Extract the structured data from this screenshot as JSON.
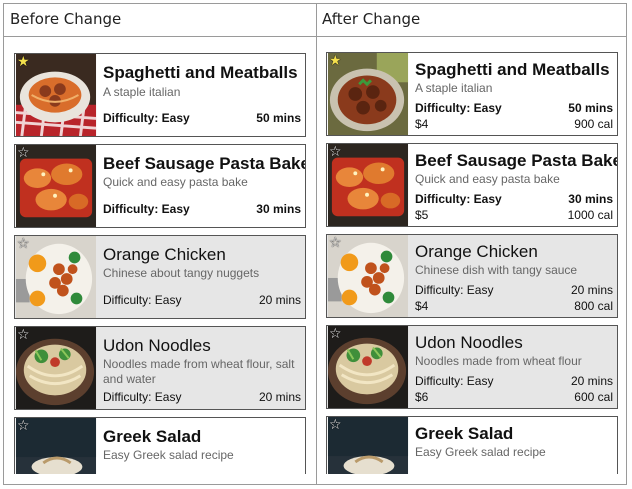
{
  "table": {
    "before_label": "Before Change",
    "after_label": "After Change"
  },
  "before": [
    {
      "title": "Spaghetti and Meatballs",
      "desc": "A staple italian",
      "difficulty": "Difficulty: Easy",
      "time": "50 mins",
      "favorite": true
    },
    {
      "title": "Beef Sausage Pasta Bake",
      "desc": "Quick and easy pasta bake",
      "difficulty": "Difficulty: Easy",
      "time": "30 mins",
      "favorite": false
    },
    {
      "title": "Orange Chicken",
      "desc": "Chinese about tangy nuggets",
      "difficulty": "Difficulty: Easy",
      "time": "20 mins",
      "favorite": false
    },
    {
      "title": "Udon Noodles",
      "desc": "Noodles made from wheat flour, salt and water",
      "difficulty": "Difficulty: Easy",
      "time": "20 mins",
      "favorite": false
    },
    {
      "title": "Greek Salad",
      "desc": "Easy Greek salad recipe",
      "favorite": false
    }
  ],
  "after": [
    {
      "title": "Spaghetti and Meatballs",
      "desc": "A staple italian",
      "difficulty": "Difficulty: Easy",
      "time": "50 mins",
      "price": "$4",
      "calories": "900 cal",
      "favorite": true
    },
    {
      "title": "Beef Sausage Pasta Bake",
      "desc": "Quick and easy pasta bake",
      "difficulty": "Difficulty: Easy",
      "time": "30 mins",
      "price": "$5",
      "calories": "1000 cal",
      "favorite": false
    },
    {
      "title": "Orange Chicken",
      "desc": "Chinese dish with tangy sauce",
      "difficulty": "Difficulty: Easy",
      "time": "20 mins",
      "price": "$4",
      "calories": "800 cal",
      "favorite": false
    },
    {
      "title": "Udon Noodles",
      "desc": "Noodles made from wheat flour",
      "difficulty": "Difficulty: Easy",
      "time": "20 mins",
      "price": "$6",
      "calories": "600 cal",
      "favorite": false
    },
    {
      "title": "Greek Salad",
      "desc": "Easy Greek salad recipe",
      "favorite": false
    }
  ],
  "icons": {
    "favorite": "star-icon",
    "accent": "#7fd3c6",
    "favorite_active": "#f4e04d"
  }
}
